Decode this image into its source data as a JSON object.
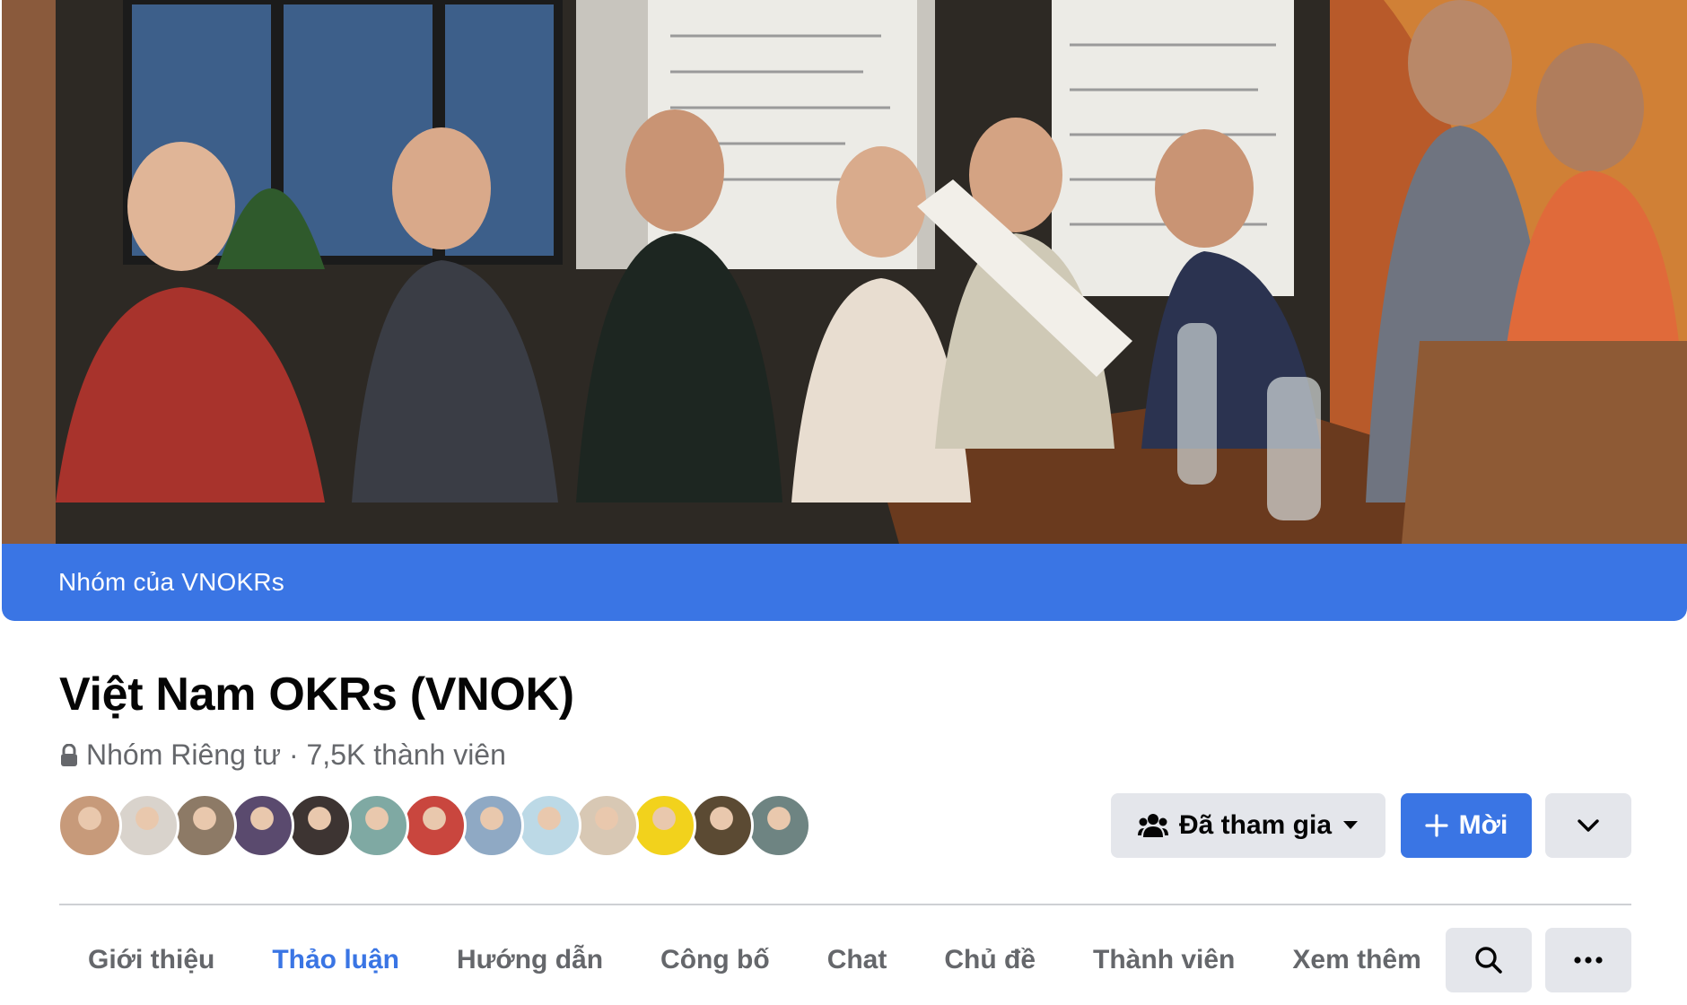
{
  "cover": {
    "banner_text": "Nhóm của VNOKRs"
  },
  "group": {
    "title": "Việt Nam OKRs (VNOK)",
    "privacy_meta": "Nhóm Riêng tư · 7,5K thành viên"
  },
  "member_avatars": [
    {
      "color": "#c79a7a"
    },
    {
      "color": "#d9d3cc"
    },
    {
      "color": "#8d7a66"
    },
    {
      "color": "#5a4a6e"
    },
    {
      "color": "#3d3432"
    },
    {
      "color": "#7fa9a3"
    },
    {
      "color": "#c9463e"
    },
    {
      "color": "#8fa9c4"
    },
    {
      "color": "#bcd9e6"
    },
    {
      "color": "#d8c8b4"
    },
    {
      "color": "#f2d21c"
    },
    {
      "color": "#5b4a33"
    },
    {
      "color": "#6e8482"
    }
  ],
  "actions": {
    "joined_label": "Đã tham gia",
    "invite_label": "Mời"
  },
  "tabs": [
    {
      "label": "Giới thiệu",
      "active": false
    },
    {
      "label": "Thảo luận",
      "active": true
    },
    {
      "label": "Hướng dẫn",
      "active": false
    },
    {
      "label": "Công bố",
      "active": false
    },
    {
      "label": "Chat",
      "active": false
    },
    {
      "label": "Chủ đề",
      "active": false
    },
    {
      "label": "Thành viên",
      "active": false
    },
    {
      "label": "Xem thêm",
      "active": false
    }
  ],
  "colors": {
    "accent": "#3a75e4",
    "button_gray": "#e4e6eb",
    "secondary_text": "#65676b"
  }
}
